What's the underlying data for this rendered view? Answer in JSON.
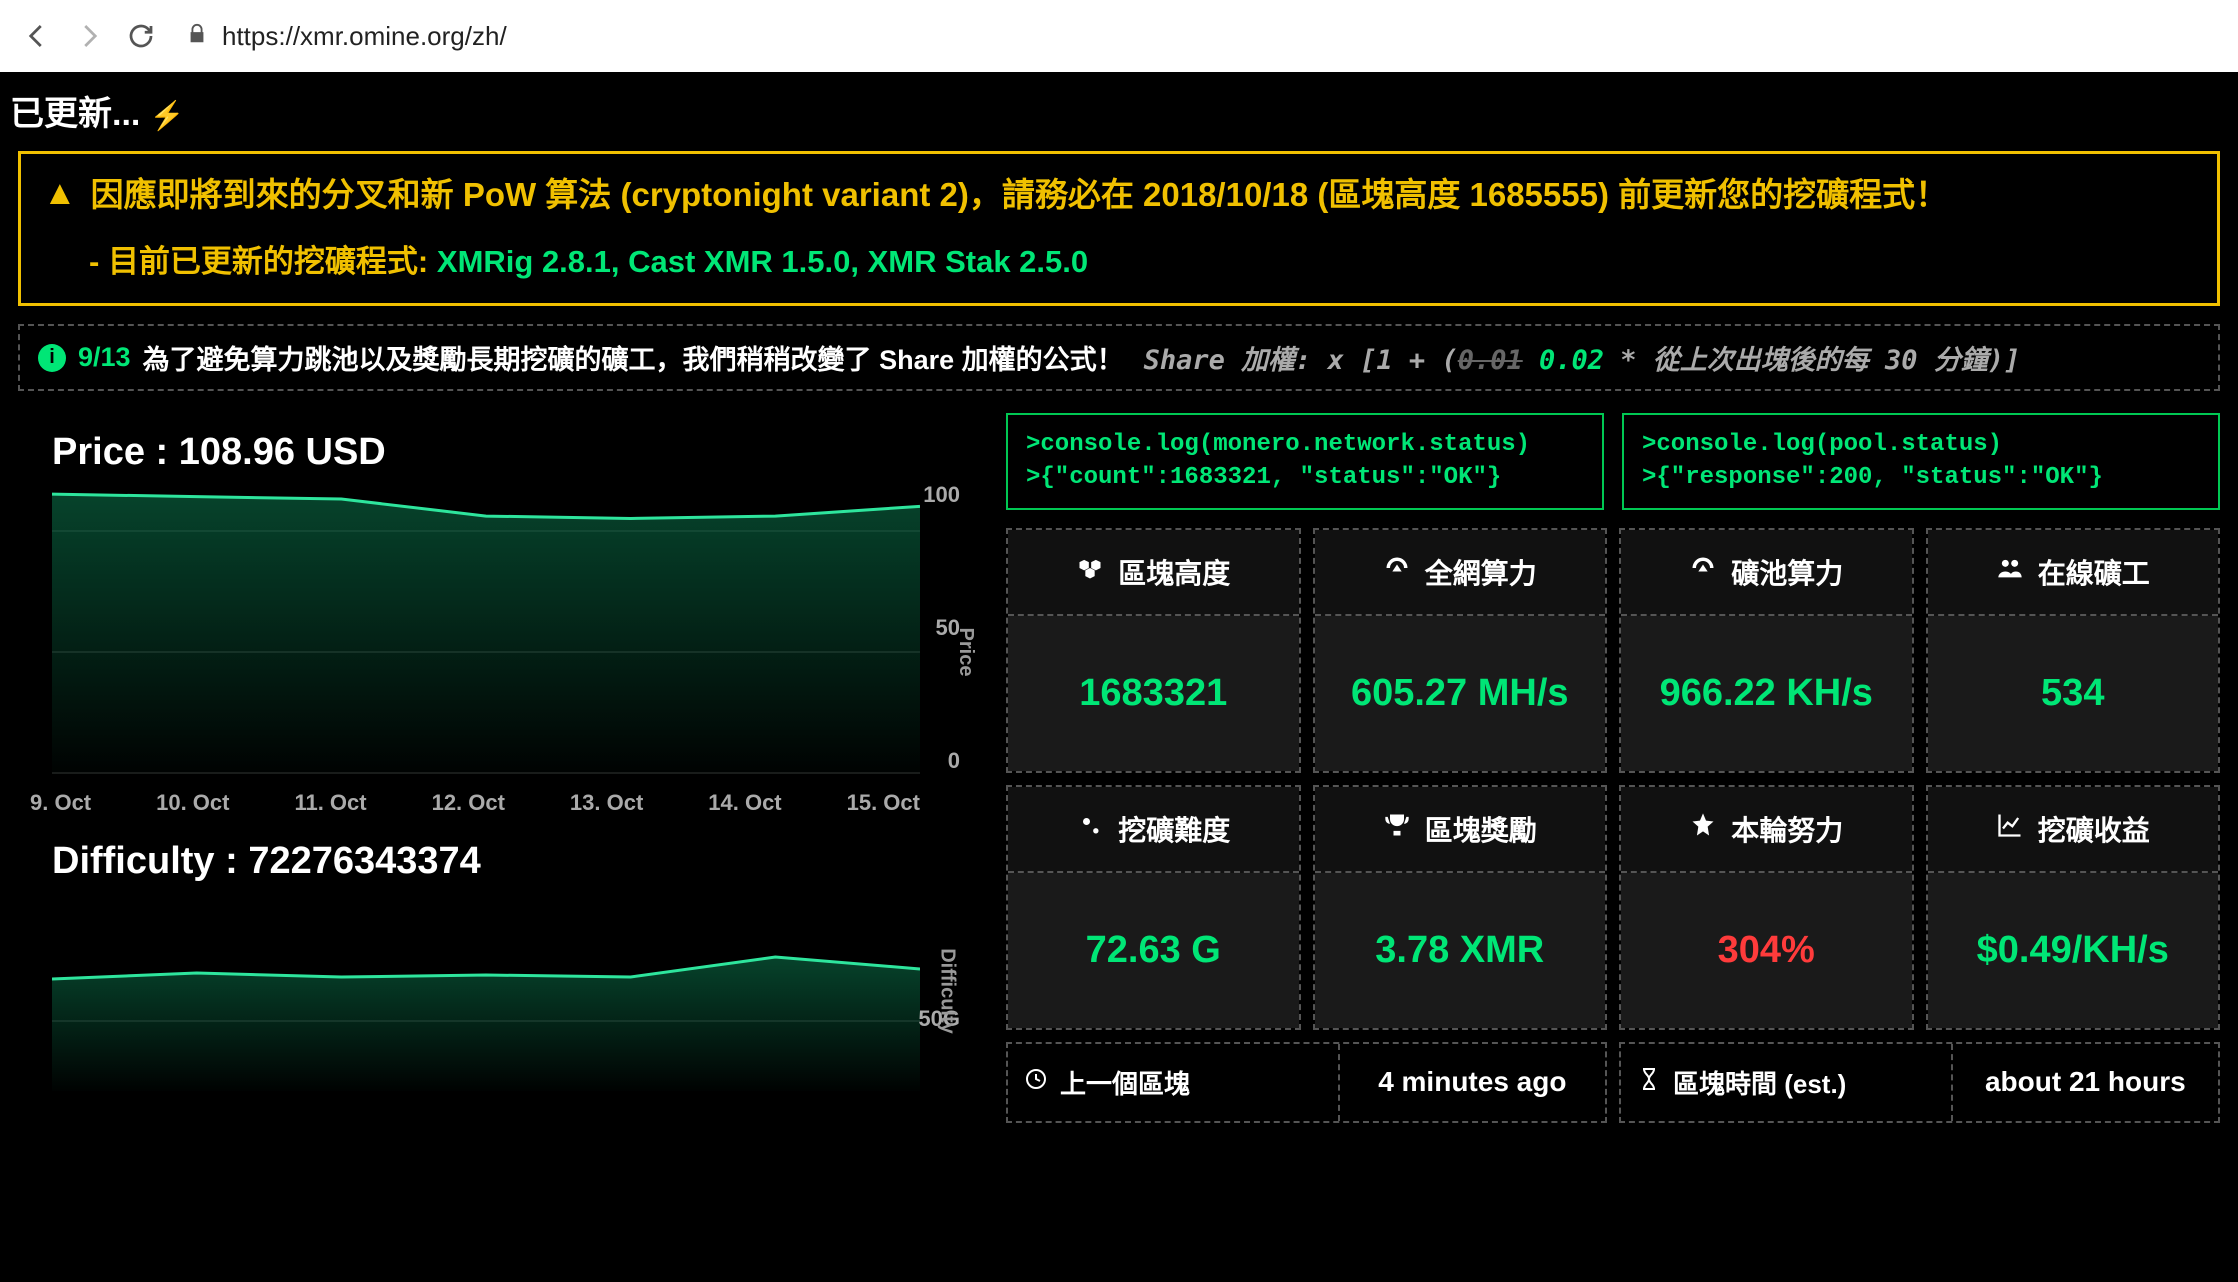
{
  "browser": {
    "url": "https://xmr.omine.org/zh/"
  },
  "top_status": {
    "text": "已更新...",
    "bolt": "⚡"
  },
  "alert": {
    "line1": "因應即將到來的分叉和新 PoW 算法 (cryptonight variant 2)，請務必在 2018/10/18 (區塊高度 1685555) 前更新您的挖礦程式！",
    "sub_label": "目前已更新的挖礦程式:",
    "sub_value": "XMRig 2.8.1, Cast XMR 1.5.0, XMR Stak 2.5.0"
  },
  "info": {
    "date": "9/13",
    "text": "為了避免算力跳池以及獎勵長期挖礦的礦工，我們稍稍改變了 Share 加權的公式！",
    "formula_prefix": "Share 加權: x [1 + (",
    "formula_old": "0.01",
    "formula_new": "0.02",
    "formula_suffix": " * 從上次出塊後的每 30 分鐘)]"
  },
  "charts": {
    "price": {
      "title": "Price : 108.96 USD",
      "y_label": "Price"
    },
    "difficulty": {
      "title": "Difficulty : 72276343374",
      "y_label": "Difficulty"
    }
  },
  "chart_data": [
    {
      "type": "line",
      "name": "price",
      "title": "Price : 108.96 USD",
      "xlabel": "",
      "ylabel": "Price",
      "ylim": [
        0,
        120
      ],
      "y_ticks": [
        "100",
        "50",
        "0"
      ],
      "x_ticks": [
        "9. Oct",
        "10. Oct",
        "11. Oct",
        "12. Oct",
        "13. Oct",
        "14. Oct",
        "15. Oct"
      ],
      "categories": [
        "9. Oct",
        "10. Oct",
        "11. Oct",
        "12. Oct",
        "13. Oct",
        "14. Oct",
        "15. Oct"
      ],
      "values": [
        115,
        114,
        113,
        106,
        105,
        106,
        110
      ]
    },
    {
      "type": "line",
      "name": "difficulty",
      "title": "Difficulty : 72276343374",
      "xlabel": "",
      "ylabel": "Difficulty",
      "ylim": [
        0,
        100
      ],
      "y_ticks": [
        "50G"
      ],
      "x_ticks": [
        "9. Oct",
        "10. Oct",
        "11. Oct",
        "12. Oct",
        "13. Oct",
        "14. Oct",
        "15. Oct"
      ],
      "categories": [
        "9. Oct",
        "10. Oct",
        "11. Oct",
        "12. Oct",
        "13. Oct",
        "14. Oct",
        "15. Oct"
      ],
      "values": [
        56,
        59,
        57,
        58,
        57,
        67,
        61
      ]
    }
  ],
  "consoles": {
    "left": ">console.log(monero.network.status)\n>{\"count\":1683321, \"status\":\"OK\"}",
    "right": ">console.log(pool.status)\n>{\"response\":200, \"status\":\"OK\"}"
  },
  "stats": [
    {
      "icon": "cubes",
      "label": "區塊高度",
      "value": "1683321",
      "color": "green"
    },
    {
      "icon": "gauge",
      "label": "全網算力",
      "value": "605.27 MH/s",
      "color": "green"
    },
    {
      "icon": "gauge",
      "label": "礦池算力",
      "value": "966.22 KH/s",
      "color": "green"
    },
    {
      "icon": "users",
      "label": "在線礦工",
      "value": "534",
      "color": "green"
    },
    {
      "icon": "cogs",
      "label": "挖礦難度",
      "value": "72.63 G",
      "color": "green"
    },
    {
      "icon": "trophy",
      "label": "區塊獎勵",
      "value": "3.78 XMR",
      "color": "green"
    },
    {
      "icon": "star",
      "label": "本輪努力",
      "value": "304%",
      "color": "red"
    },
    {
      "icon": "chart",
      "label": "挖礦收益",
      "value": "$0.49/KH/s",
      "color": "green"
    }
  ],
  "bottom": [
    {
      "icon": "clock",
      "label": "上一個區塊",
      "value": "4 minutes ago"
    },
    {
      "icon": "hourglass",
      "label": "區塊時間 (est.)",
      "value": "about 21 hours"
    }
  ]
}
